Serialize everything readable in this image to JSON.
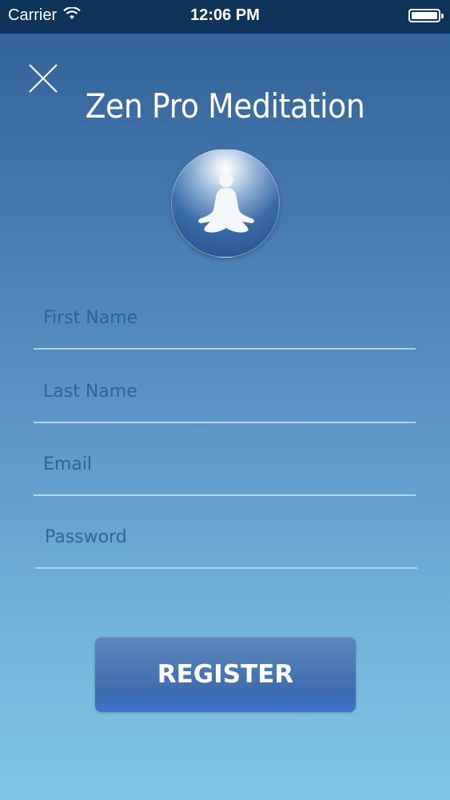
{
  "status_bar": {
    "carrier": "Carrier",
    "time": "12:06 PM",
    "wifi_icon": "wifi-icon",
    "battery_icon": "battery-icon"
  },
  "header": {
    "close_icon": "close-icon",
    "title": "Zen Pro Meditation",
    "logo_icon": "meditation-figure-icon"
  },
  "form": {
    "first_name": {
      "placeholder": "First Name",
      "value": ""
    },
    "last_name": {
      "placeholder": "Last Name",
      "value": ""
    },
    "email": {
      "placeholder": "Email",
      "value": ""
    },
    "password": {
      "placeholder": "Password",
      "value": ""
    }
  },
  "register_button": {
    "label": "REGISTER"
  },
  "colors": {
    "status_bar_bg": "#0f3459",
    "gradient_top": "#2f5f95",
    "gradient_bottom": "#80c6e6",
    "placeholder": "#2b5a8a",
    "button": "#4a77b2"
  }
}
